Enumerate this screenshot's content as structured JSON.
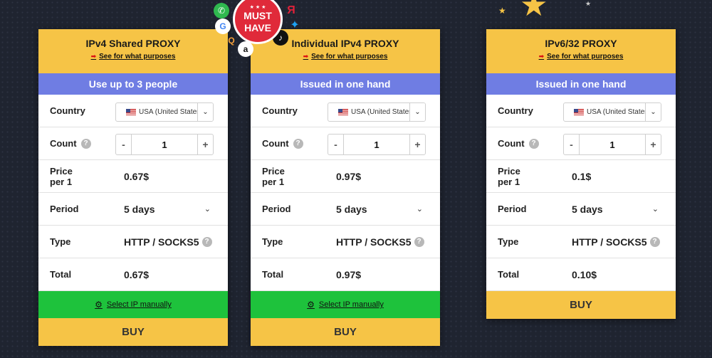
{
  "badge": {
    "line1": "MUST",
    "line2": "HAVE",
    "stars": "★ ★ ★"
  },
  "social_icons": {
    "whatsapp": "✆",
    "google": "G",
    "quora": "Q",
    "amazon": "a",
    "yandex": "Я",
    "tiktok": "♪",
    "twitter": "✦"
  },
  "cards": [
    {
      "title": "IPv4 Shared PROXY",
      "link": "See for what purposes",
      "band": "Use up to 3 people",
      "country_label": "Country",
      "country_value": "USA (United States)",
      "count_label": "Count",
      "count_value": "1",
      "price_label_1": "Price",
      "price_label_2": "per 1",
      "price_value": "0.67$",
      "period_label": "Period",
      "period_value": "5 days",
      "type_label": "Type",
      "type_value": "HTTP / SOCKS5",
      "total_label": "Total",
      "total_value": "0.67$",
      "select_ip": "Select IP manually",
      "buy": "BUY"
    },
    {
      "title": "Individual IPv4 PROXY",
      "link": "See for what purposes",
      "band": "Issued in one hand",
      "country_label": "Country",
      "country_value": "USA (United States)",
      "count_label": "Count",
      "count_value": "1",
      "price_label_1": "Price",
      "price_label_2": "per 1",
      "price_value": "0.97$",
      "period_label": "Period",
      "period_value": "5 days",
      "type_label": "Type",
      "type_value": "HTTP / SOCKS5",
      "total_label": "Total",
      "total_value": "0.97$",
      "select_ip": "Select IP manually",
      "buy": "BUY"
    },
    {
      "title": "IPv6/32 PROXY",
      "link": "See for what purposes",
      "band": "Issued in one hand",
      "country_label": "Country",
      "country_value": "USA (United States)",
      "count_label": "Count",
      "count_value": "1",
      "price_label_1": "Price",
      "price_label_2": "per 1",
      "price_value": "0.1$",
      "period_label": "Period",
      "period_value": "5 days",
      "type_label": "Type",
      "type_value": "HTTP / SOCKS5",
      "total_label": "Total",
      "total_value": "0.10$",
      "buy": "BUY"
    }
  ],
  "symbols": {
    "minus": "-",
    "plus": "+",
    "chevron": "⌄",
    "help": "?",
    "arrow": "➡",
    "gear": "⚙"
  }
}
